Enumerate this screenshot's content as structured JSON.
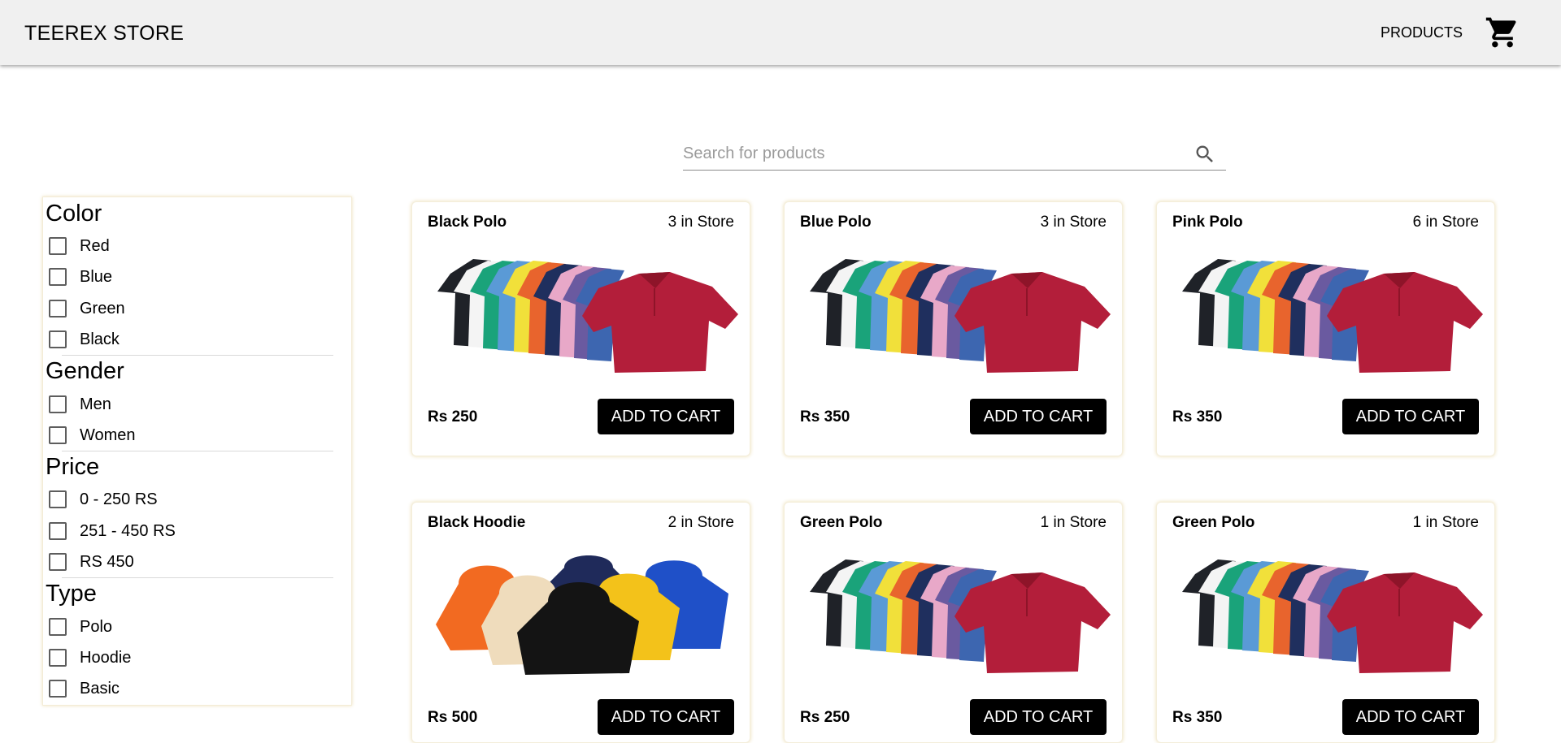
{
  "header": {
    "brand": "TEEREX STORE",
    "nav_products": "PRODUCTS",
    "cart_icon": "shopping-cart-icon"
  },
  "search": {
    "placeholder": "Search for products",
    "value": "",
    "icon": "search-icon"
  },
  "filters": {
    "color": {
      "title": "Color",
      "options": [
        "Red",
        "Blue",
        "Green",
        "Black"
      ]
    },
    "gender": {
      "title": "Gender",
      "options": [
        "Men",
        "Women"
      ]
    },
    "price": {
      "title": "Price",
      "options": [
        "0 - 250 RS",
        "251 - 450 RS",
        "RS 450"
      ]
    },
    "type": {
      "title": "Type",
      "options": [
        "Polo",
        "Hoodie",
        "Basic"
      ]
    }
  },
  "products": [
    {
      "name": "Black Polo",
      "stock": "3 in Store",
      "price": "Rs 250",
      "button": "ADD TO CART",
      "image": "polo-shirts-image"
    },
    {
      "name": "Blue Polo",
      "stock": "3 in Store",
      "price": "Rs 350",
      "button": "ADD TO CART",
      "image": "polo-shirts-image"
    },
    {
      "name": "Pink Polo",
      "stock": "6 in Store",
      "price": "Rs 350",
      "button": "ADD TO CART",
      "image": "polo-shirts-image"
    },
    {
      "name": "Black Hoodie",
      "stock": "2 in Store",
      "price": "Rs 500",
      "button": "ADD TO CART",
      "image": "hoodies-image"
    },
    {
      "name": "Green Polo",
      "stock": "1 in Store",
      "price": "Rs 250",
      "button": "ADD TO CART",
      "image": "polo-shirts-image"
    },
    {
      "name": "Green Polo",
      "stock": "1 in Store",
      "price": "Rs 350",
      "button": "ADD TO CART",
      "image": "polo-shirts-image"
    }
  ],
  "colors": {
    "appbar_bg": "#f0f0f0",
    "button_bg": "#000000",
    "button_text": "#ffffff"
  }
}
